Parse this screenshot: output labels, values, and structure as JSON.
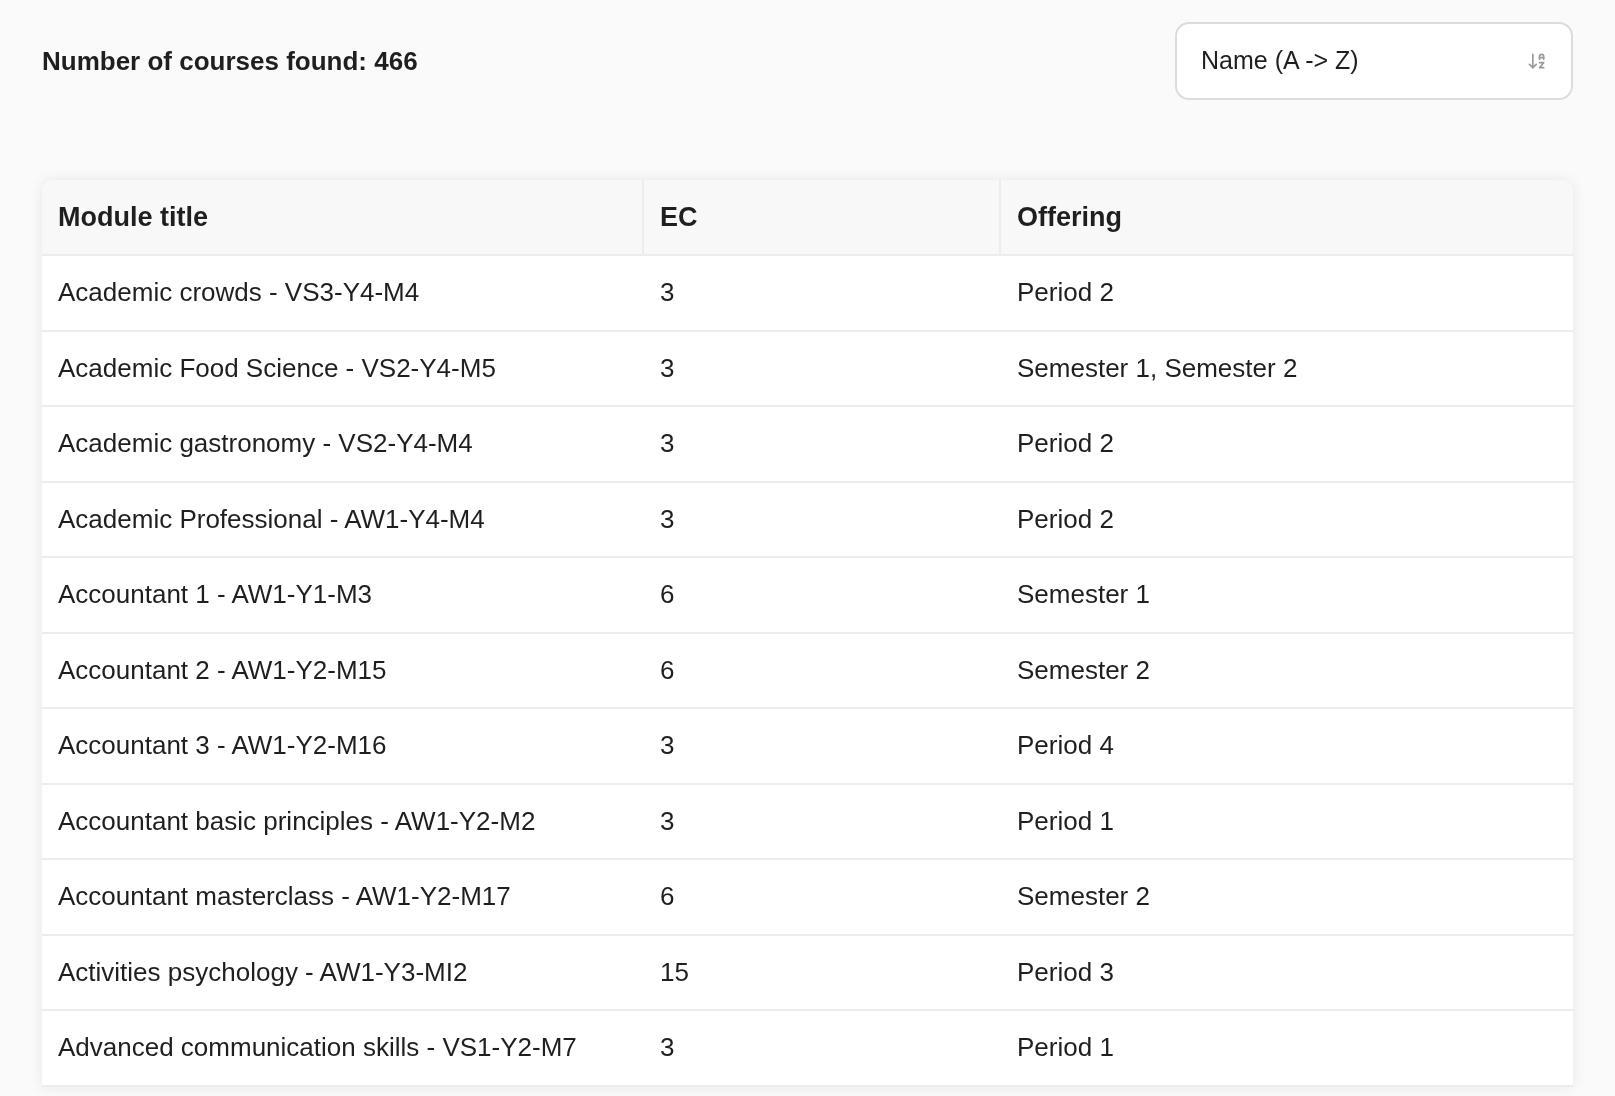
{
  "summary": {
    "label": "Number of courses found: 466"
  },
  "sort": {
    "value": "Name (A -> Z)"
  },
  "table": {
    "columns": [
      "Module title",
      "EC",
      "Offering"
    ],
    "rows": [
      [
        "Academic crowds - VS3-Y4-M4",
        "3",
        "Period 2"
      ],
      [
        "Academic Food Science - VS2-Y4-M5",
        "3",
        "Semester 1, Semester 2"
      ],
      [
        "Academic gastronomy - VS2-Y4-M4",
        "3",
        "Period 2"
      ],
      [
        "Academic Professional - AW1-Y4-M4",
        "3",
        "Period 2"
      ],
      [
        "Accountant 1 - AW1-Y1-M3",
        "6",
        "Semester 1"
      ],
      [
        "Accountant 2 - AW1-Y2-M15",
        "6",
        "Semester 2"
      ],
      [
        "Accountant 3 - AW1-Y2-M16",
        "3",
        "Period 4"
      ],
      [
        "Accountant basic principles - AW1-Y2-M2",
        "3",
        "Period 1"
      ],
      [
        "Accountant masterclass - AW1-Y2-M17",
        "6",
        "Semester 2"
      ],
      [
        "Activities psychology - AW1-Y3-MI2",
        "15",
        "Period 3"
      ],
      [
        "Advanced communication skills - VS1-Y2-M7",
        "3",
        "Period 1"
      ]
    ]
  }
}
